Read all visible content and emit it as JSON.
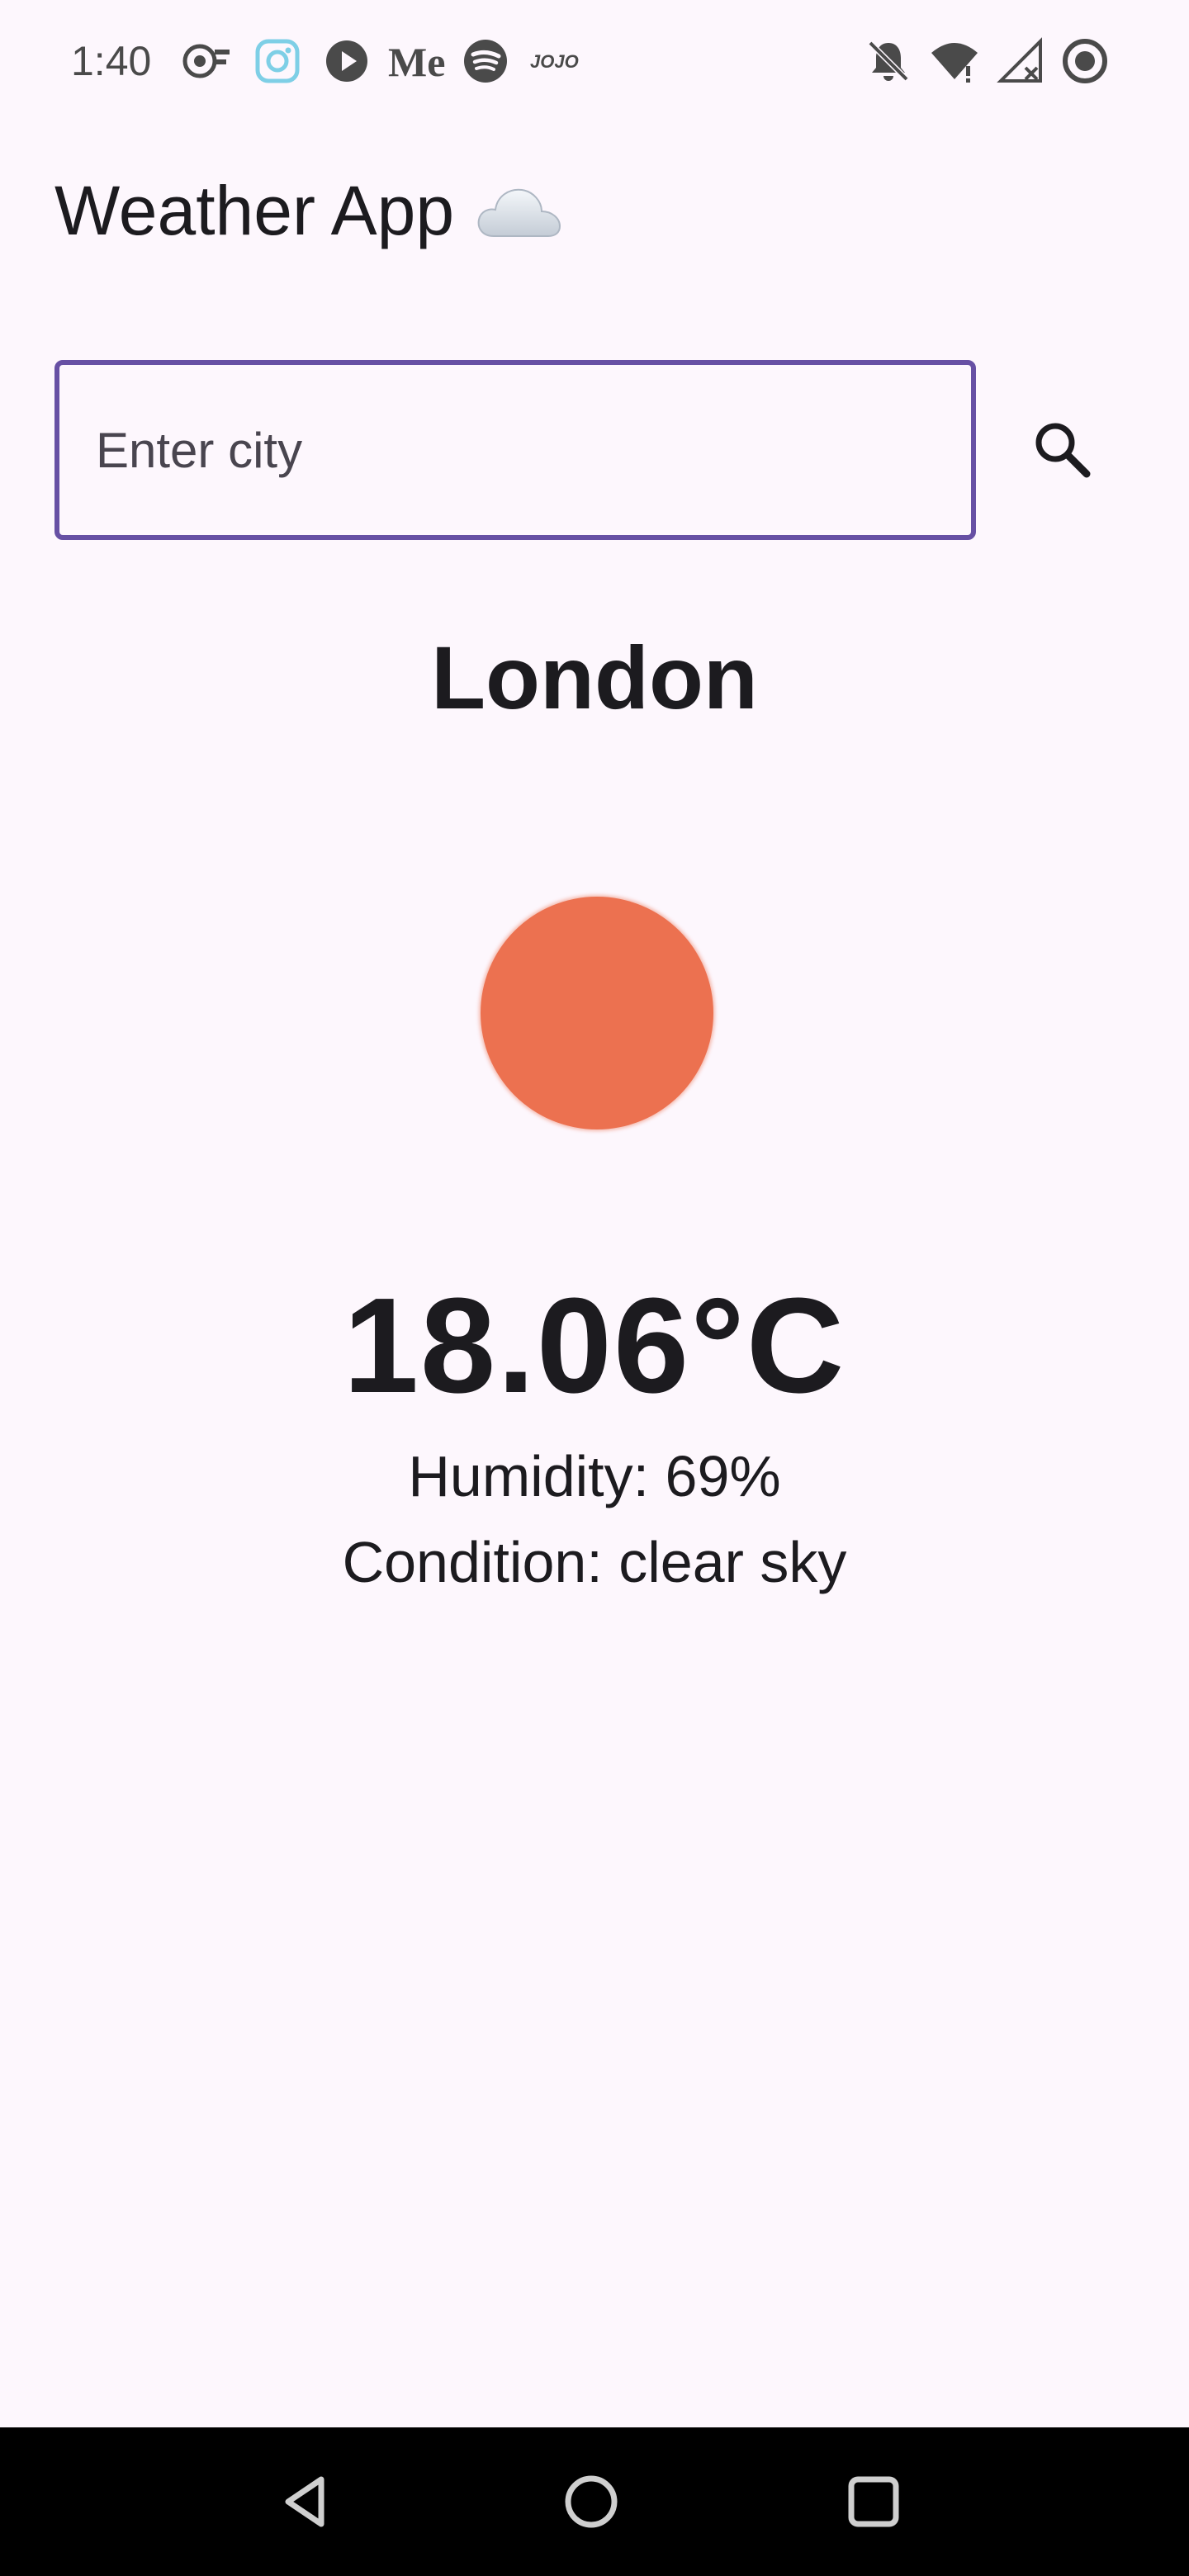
{
  "status_bar": {
    "time": "1:40",
    "icons": [
      "podcast-app-icon",
      "instagram-icon",
      "play-icon",
      "medium-icon",
      "spotify-icon",
      "jojo-icon",
      "notifications-off-icon",
      "wifi-icon",
      "cellular-no-signal-icon",
      "battery-saver-icon"
    ]
  },
  "app_bar": {
    "title": "Weather App"
  },
  "search": {
    "placeholder": "Enter city",
    "value": ""
  },
  "weather": {
    "city": "London",
    "icon": "sun-icon",
    "icon_color": "#ec7150",
    "temperature": "18.06°C",
    "humidity": "Humidity: 69%",
    "condition": "Condition: clear sky"
  },
  "theme": {
    "background": "#fdf7fd",
    "accent": "#6750a4",
    "text": "#1c1b1f"
  },
  "nav_bar": {
    "buttons": [
      "back-icon",
      "home-icon",
      "recents-icon"
    ]
  }
}
